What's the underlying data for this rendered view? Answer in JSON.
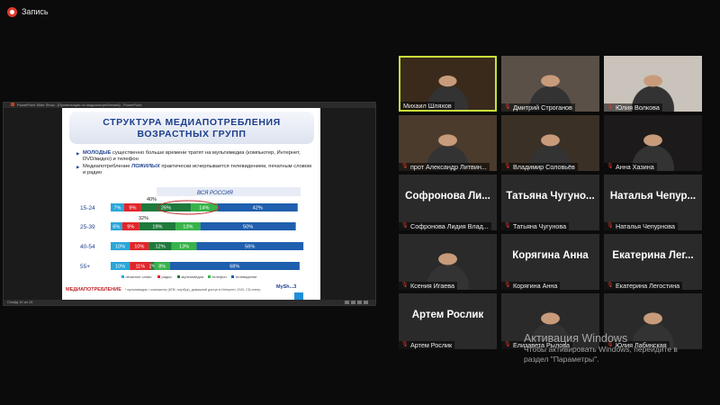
{
  "recording": {
    "label": "Запись"
  },
  "share": {
    "window_title": "PowerPoint Slide Show - [Презентация по медиапотреблению] - PowerPoint",
    "status_text": "Слайд 10 из 15",
    "slide": {
      "title_line1": "СТРУКТУРА МЕДИАПОТРЕБЛЕНИЯ",
      "title_line2": "ВОЗРАСТНЫХ ГРУПП",
      "bullet1_hl": "МОЛОДЫЕ",
      "bullet1_rest": " существенно больше времени тратят на мультимедиа (компьютер, Интернет, DVD/видео) и телефон",
      "bullet2_pre": "Медиапотребление ",
      "bullet2_hl": "ПОЖИЛЫХ",
      "bullet2_rest": " практически исчерпывается телевидением, печатным словом и радио",
      "footer": "МЕДИАПОТРЕБЛЕНИЕ",
      "footnote": "* мультимедиа = компьютер (КПК, ноутбук), домашний доступ в Интернет, DVD, CD-плеер",
      "logo": "MySh...3"
    }
  },
  "chart_data": {
    "type": "bar",
    "stacked": true,
    "orientation": "horizontal",
    "title": "ВСЯ РОССИЯ",
    "categories": [
      "15-24",
      "25-39",
      "40-54",
      "55+"
    ],
    "series": [
      {
        "name": "печатное слово",
        "color": "#2aa6d9",
        "values": [
          7,
          6,
          10,
          10
        ]
      },
      {
        "name": "радио",
        "color": "#e0262b",
        "values": [
          9,
          9,
          10,
          11
        ]
      },
      {
        "name": "мультимедиа",
        "color": "#1f7a3c",
        "values": [
          26,
          19,
          12,
          2
        ]
      },
      {
        "name": "телефон",
        "color": "#37b34a",
        "values": [
          14,
          13,
          13,
          8
        ]
      },
      {
        "name": "телевидение",
        "color": "#1f5fae",
        "values": [
          42,
          50,
          56,
          68
        ]
      }
    ],
    "value_labels": [
      [
        "7%",
        "9%",
        "26%",
        "14%",
        "42%"
      ],
      [
        "6%",
        "9%",
        "19%",
        "13%",
        "50%"
      ],
      [
        "10%",
        "10%",
        "12%",
        "13%",
        "56%"
      ],
      [
        "10%",
        "11%",
        "2%",
        "8%",
        "68%"
      ]
    ],
    "annotations": [
      {
        "text": "40%",
        "category": "15-24"
      },
      {
        "text": "32%",
        "category": "25-39"
      }
    ],
    "xlim": [
      0,
      100
    ],
    "legend_position": "bottom"
  },
  "participants": [
    {
      "name": "Михаил Шляхов",
      "video": true,
      "muted": false,
      "active": true,
      "bg": "#3a2a1c"
    },
    {
      "name": "Дмитрий Строганов",
      "video": true,
      "muted": true,
      "active": false,
      "bg": "#5a5048"
    },
    {
      "name": "Юлия Волкова",
      "video": true,
      "muted": true,
      "active": false,
      "bg": "#c9c3bb"
    },
    {
      "name": "прот Александр Литвин...",
      "video": true,
      "muted": true,
      "active": false,
      "bg": "#4b3b2d"
    },
    {
      "name": "Владимир Соловьёв",
      "video": true,
      "muted": true,
      "active": false,
      "bg": "#3b3026"
    },
    {
      "name": "Анна Хазина",
      "video": true,
      "muted": true,
      "active": false,
      "bg": "#1c1a1a"
    },
    {
      "name": "Софронова Лидия Влад...",
      "big": "Софронова Ли...",
      "video": false,
      "muted": true,
      "active": false
    },
    {
      "name": "Татьяна Чугунова",
      "big": "Татьяна Чугуно...",
      "video": false,
      "muted": true,
      "active": false
    },
    {
      "name": "Наталья Чепурнова",
      "big": "Наталья Чепур...",
      "video": false,
      "muted": true,
      "active": false
    },
    {
      "name": "Ксения Игаева",
      "video": true,
      "muted": true,
      "active": false,
      "bg": "#2a2a2a"
    },
    {
      "name": "Корягина Анна",
      "big": "Корягина Анна",
      "video": false,
      "muted": true,
      "active": false
    },
    {
      "name": "Екатерина Легостина",
      "big": "Екатерина Лег...",
      "video": false,
      "muted": true,
      "active": false
    },
    {
      "name": "Артем Рослик",
      "big": "Артем Рослик",
      "video": false,
      "muted": true,
      "active": false
    },
    {
      "name": "Елизавета Рылова",
      "video": true,
      "muted": true,
      "active": false,
      "bg": "#2a2a2a"
    },
    {
      "name": "Юлия Лабинская",
      "video": true,
      "muted": true,
      "active": false,
      "bg": "#2a2a2a"
    }
  ],
  "watermark": {
    "title": "Активация Windows",
    "line1": "Чтобы активировать Windows, перейдите в",
    "line2": "раздел \"Параметры\"."
  },
  "icons": {
    "record": "record-icon",
    "mute": "mic-muted-icon"
  }
}
